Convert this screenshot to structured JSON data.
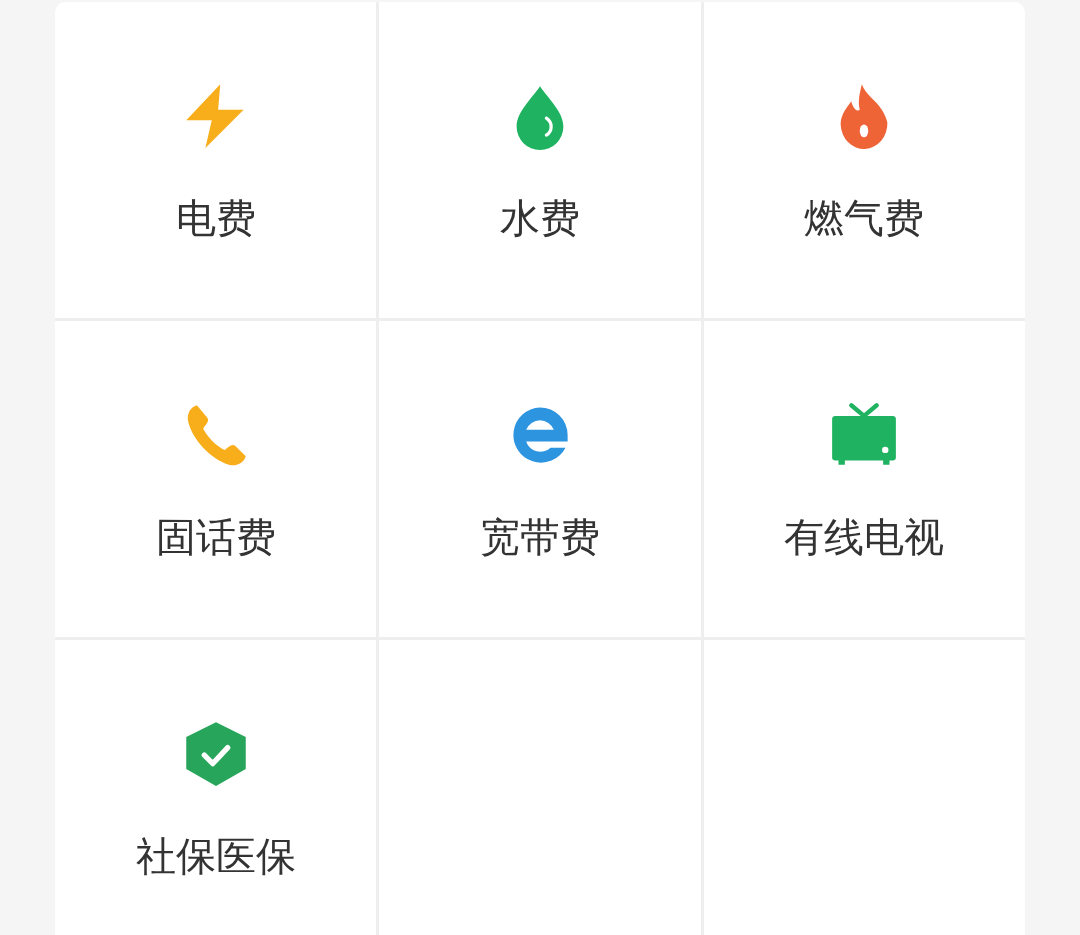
{
  "services": [
    {
      "kind": "bolt",
      "label": "电费",
      "color": "#f8ad1a"
    },
    {
      "kind": "drop",
      "label": "水费",
      "color": "#1fb361"
    },
    {
      "kind": "flame",
      "label": "燃气费",
      "color": "#ee6437"
    },
    {
      "kind": "phone",
      "label": "固话费",
      "color": "#f8ad1a"
    },
    {
      "kind": "broadband",
      "label": "宽带费",
      "color": "#2d94e0"
    },
    {
      "kind": "tv",
      "label": "有线电视",
      "color": "#1fb361"
    },
    {
      "kind": "shield",
      "label": "社保医保",
      "color": "#27a55a"
    }
  ]
}
